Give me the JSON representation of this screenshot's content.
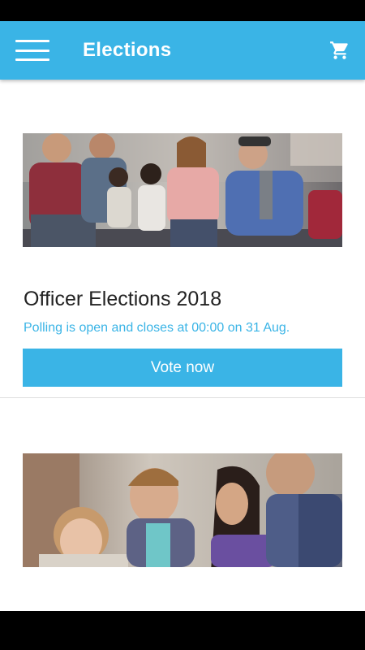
{
  "app_bar": {
    "title": "Elections",
    "menu_icon": "hamburger-menu-icon",
    "cart_icon": "shopping-cart-icon",
    "color": "#3ab4e6"
  },
  "elections": [
    {
      "title": "Officer Elections 2018",
      "status": "Polling is open and closes at 00:00 on 31 Aug.",
      "button_label": "Vote now"
    }
  ]
}
